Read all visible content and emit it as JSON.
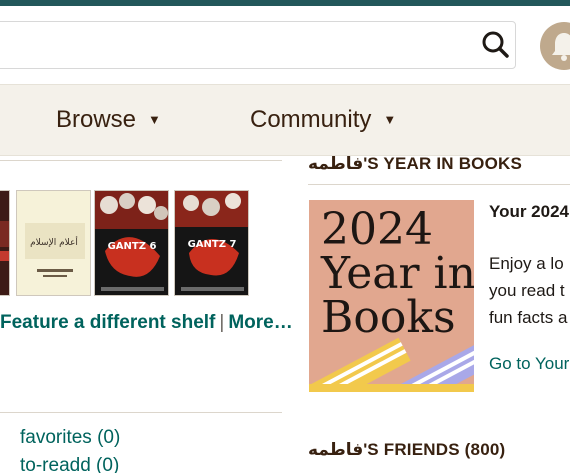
{
  "header": {
    "search": {
      "placeholder": "",
      "value": ""
    }
  },
  "nav": {
    "browse_label": "Browse",
    "community_label": "Community",
    "caret": "▼"
  },
  "shelf": {
    "book_2_title": "أعلام الإسلام",
    "book_3_title": "GANTZ 6",
    "book_4_title": "GANTZ 7",
    "feature_link": "Feature a different shelf",
    "separator": "|",
    "more_link": "More…",
    "shelves": [
      {
        "label": "favorites (0)"
      },
      {
        "label": "to-readd (0)"
      }
    ]
  },
  "year_in_books": {
    "section_title": "فاطمه'S YEAR IN BOOKS",
    "card_text": "2024\nYear in\nBooks",
    "heading": "Your 2024",
    "body": "Enjoy a lo\nyou read t\nfun facts a",
    "link": "Go to Your"
  },
  "friends": {
    "section_title": "فاطمه'S FRIENDS (800)"
  },
  "colors": {
    "topbar": "#22575a",
    "nav_bg": "#f4f1ea",
    "link": "#00635d",
    "card_bg": "#e1a78f"
  }
}
